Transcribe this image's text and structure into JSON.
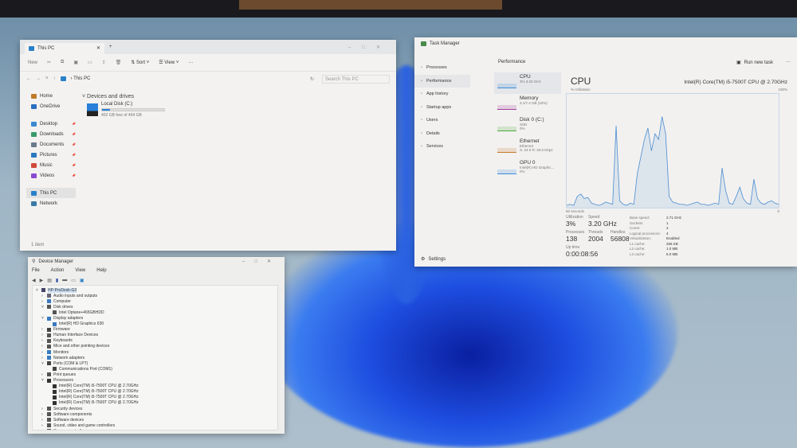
{
  "explorer": {
    "tab_title": "This PC",
    "new_tab": "+",
    "cmd": {
      "new": "New",
      "sort": "Sort",
      "view": "View",
      "more": "···"
    },
    "address": "This PC",
    "search_placeholder": "Search This PC",
    "nav": [
      {
        "label": "Home",
        "color": "#c07a2a"
      },
      {
        "label": "OneDrive",
        "color": "#2a6fc0"
      },
      {
        "label": "Desktop",
        "color": "#3a8ad0"
      },
      {
        "label": "Downloads",
        "color": "#3a9a6a"
      },
      {
        "label": "Documents",
        "color": "#6a7a8a"
      },
      {
        "label": "Pictures",
        "color": "#2a7ac0"
      },
      {
        "label": "Music",
        "color": "#d04a3a"
      },
      {
        "label": "Videos",
        "color": "#8a4ad0"
      },
      {
        "label": "This PC",
        "color": "#2a80c8"
      },
      {
        "label": "Network",
        "color": "#3a7aa8"
      }
    ],
    "section": "Devices and drives",
    "drive": {
      "name": "Local Disk (C:)",
      "free": "402 GB free of 464 GB",
      "used_fraction": 0.13
    },
    "status": "1 item"
  },
  "taskmgr": {
    "title": "Task Manager",
    "header": "Performance",
    "run_task": "Run new task",
    "more": "···",
    "side": [
      "Processes",
      "Performance",
      "App history",
      "Startup apps",
      "Users",
      "Details",
      "Services"
    ],
    "settings": "Settings",
    "resources": [
      {
        "name": "CPU",
        "l1": "3% 3.20 GHz",
        "l2": "",
        "color": "#3c8ad8"
      },
      {
        "name": "Memory",
        "l1": "3.1/7.4 GB (42%)",
        "l2": "",
        "color": "#a03c9c"
      },
      {
        "name": "Disk 0 (C:)",
        "l1": "SSD",
        "l2": "0%",
        "color": "#4caa3c"
      },
      {
        "name": "Ethernet",
        "l1": "Ethernet",
        "l2": "S: 24.0 R: 40.0 Kbps",
        "color": "#c87a2c"
      },
      {
        "name": "GPU 0",
        "l1": "Intel(R) HD Graphic...",
        "l2": "0%",
        "color": "#3c8ad8"
      }
    ],
    "cpu_title": "CPU",
    "cpu_model": "Intel(R) Core(TM) i5-7500T CPU @ 2.70GHz",
    "util_label": "% Utilization",
    "max_label": "100%",
    "time_label": "60 seconds",
    "zero": "0",
    "stats": {
      "utilization_label": "Utilization",
      "utilization": "3%",
      "speed_label": "Speed",
      "speed": "3.20 GHz",
      "processes_label": "Processes",
      "processes": "138",
      "threads_label": "Threads",
      "threads": "2004",
      "handles_label": "Handles",
      "handles": "56808",
      "uptime_label": "Up time",
      "uptime": "0:00:08:56"
    },
    "specs": [
      [
        "Base speed:",
        "2.71 GHz"
      ],
      [
        "Sockets:",
        "1"
      ],
      [
        "Cores:",
        "4"
      ],
      [
        "Logical processors:",
        "4"
      ],
      [
        "Virtualization:",
        "Enabled"
      ],
      [
        "L1 cache:",
        "256 KB"
      ],
      [
        "L2 cache:",
        "1.0 MB"
      ],
      [
        "L3 cache:",
        "6.0 MB"
      ]
    ],
    "cpu_history": [
      2,
      3,
      2,
      10,
      12,
      8,
      9,
      4,
      3,
      2,
      3,
      5,
      4,
      3,
      72,
      6,
      3,
      2,
      4,
      3,
      30,
      45,
      60,
      70,
      50,
      65,
      60,
      80,
      65,
      10,
      5,
      4,
      3,
      3,
      2,
      3,
      4,
      5,
      3,
      3,
      2,
      3,
      4,
      3,
      35,
      15,
      4,
      3,
      10,
      18,
      8,
      4,
      3,
      25,
      8,
      4,
      3,
      5,
      6,
      4,
      3
    ]
  },
  "devmgr": {
    "title": "Device Manager",
    "menu": [
      "File",
      "Action",
      "View",
      "Help"
    ],
    "tree": [
      {
        "d": 0,
        "t": "HP-ProDesk-G3",
        "c": "#446"
      },
      {
        "d": 1,
        "t": "Audio inputs and outputs",
        "c": "#667"
      },
      {
        "d": 1,
        "t": "Computer",
        "c": "#3a7ac0"
      },
      {
        "d": 1,
        "t": "Disk drives",
        "c": "#555"
      },
      {
        "d": 2,
        "t": "Intel Optane+465GBHDD",
        "c": "#555"
      },
      {
        "d": 1,
        "t": "Display adapters",
        "c": "#3a7ac0"
      },
      {
        "d": 2,
        "t": "Intel(R) HD Graphics 630",
        "c": "#3a7ac0"
      },
      {
        "d": 1,
        "t": "Firmware",
        "c": "#444"
      },
      {
        "d": 1,
        "t": "Human Interface Devices",
        "c": "#555"
      },
      {
        "d": 1,
        "t": "Keyboards",
        "c": "#555"
      },
      {
        "d": 1,
        "t": "Mice and other pointing devices",
        "c": "#555"
      },
      {
        "d": 1,
        "t": "Monitors",
        "c": "#3a7ac0"
      },
      {
        "d": 1,
        "t": "Network adapters",
        "c": "#3a7ac0"
      },
      {
        "d": 1,
        "t": "Ports (COM & LPT)",
        "c": "#444"
      },
      {
        "d": 2,
        "t": "Communications Port (COM1)",
        "c": "#444"
      },
      {
        "d": 1,
        "t": "Print queues",
        "c": "#555"
      },
      {
        "d": 1,
        "t": "Processors",
        "c": "#333"
      },
      {
        "d": 2,
        "t": "Intel(R) Core(TM) i5-7500T CPU @ 2.70GHz",
        "c": "#333"
      },
      {
        "d": 2,
        "t": "Intel(R) Core(TM) i5-7500T CPU @ 2.70GHz",
        "c": "#333"
      },
      {
        "d": 2,
        "t": "Intel(R) Core(TM) i5-7500T CPU @ 2.70GHz",
        "c": "#333"
      },
      {
        "d": 2,
        "t": "Intel(R) Core(TM) i5-7500T CPU @ 2.70GHz",
        "c": "#333"
      },
      {
        "d": 1,
        "t": "Security devices",
        "c": "#555"
      },
      {
        "d": 1,
        "t": "Software components",
        "c": "#555"
      },
      {
        "d": 1,
        "t": "Software devices",
        "c": "#555"
      },
      {
        "d": 1,
        "t": "Sound, video and game controllers",
        "c": "#555"
      },
      {
        "d": 1,
        "t": "Storage controllers",
        "c": "#555"
      }
    ]
  }
}
